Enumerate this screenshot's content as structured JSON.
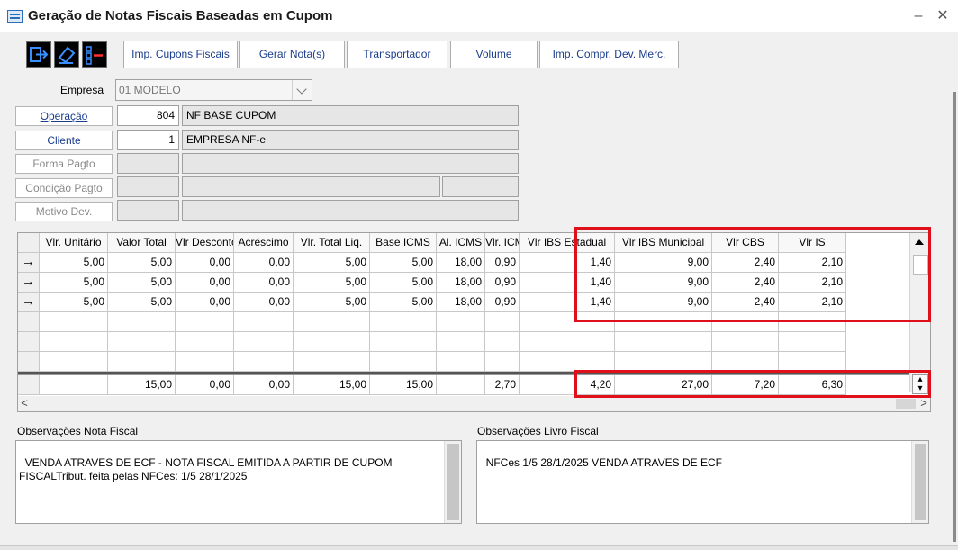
{
  "window": {
    "title": "Geração de Notas Fiscais Baseadas em Cupom",
    "minimize_glyph": "–",
    "close_glyph": "✕"
  },
  "toolbar": {
    "icons": [
      "exit-icon",
      "eraser-icon",
      "list-remove-icon"
    ],
    "buttons": [
      "Imp. Cupons Fiscais",
      "Gerar Nota(s)",
      "Transportador",
      "Volume",
      "Imp. Compr. Dev. Merc."
    ]
  },
  "form": {
    "empresa_label": "Empresa",
    "empresa_value": "01 MODELO",
    "operacao_label": "Operação",
    "operacao_code": "804",
    "operacao_desc": "NF BASE CUPOM",
    "cliente_label": "Cliente",
    "cliente_code": "1",
    "cliente_desc": "EMPRESA NF-e",
    "forma_pagto_label": "Forma Pagto",
    "condicao_pagto_label": "Condição Pagto",
    "motivo_dev_label": "Motivo Dev."
  },
  "grid": {
    "columns": [
      "Vlr. Unitário",
      "Valor Total",
      "Vlr Desconto",
      "Acréscimo",
      "Vlr. Total Liq.",
      "Base ICMS",
      "Al. ICMS",
      "Vlr. ICMS",
      "Vlr IBS Estadual",
      "Vlr IBS Municipal",
      "Vlr CBS",
      "Vlr IS"
    ],
    "row_indicator": "→",
    "rows": [
      [
        "5,00",
        "5,00",
        "0,00",
        "0,00",
        "5,00",
        "5,00",
        "18,00",
        "0,90",
        "1,40",
        "9,00",
        "2,40",
        "2,10"
      ],
      [
        "5,00",
        "5,00",
        "0,00",
        "0,00",
        "5,00",
        "5,00",
        "18,00",
        "0,90",
        "1,40",
        "9,00",
        "2,40",
        "2,10"
      ],
      [
        "5,00",
        "5,00",
        "0,00",
        "0,00",
        "5,00",
        "5,00",
        "18,00",
        "0,90",
        "1,40",
        "9,00",
        "2,40",
        "2,10"
      ]
    ],
    "totals": [
      "",
      "15,00",
      "0,00",
      "0,00",
      "15,00",
      "15,00",
      "",
      "2,70",
      "4,20",
      "27,00",
      "7,20",
      "6,30"
    ]
  },
  "observacoes": {
    "nota_label": "Observações Nota Fiscal",
    "nota_text": "VENDA ATRAVES DE ECF - NOTA FISCAL EMITIDA A PARTIR DE CUPOM FISCALTribut. feita pelas NFCes: 1/5 28/1/2025",
    "livro_label": "Observações Livro Fiscal",
    "livro_text": "NFCes 1/5 28/1/2025 VENDA ATRAVES DE ECF"
  },
  "colors": {
    "highlight": "#e0101a",
    "link_text": "#1a3c8c"
  }
}
